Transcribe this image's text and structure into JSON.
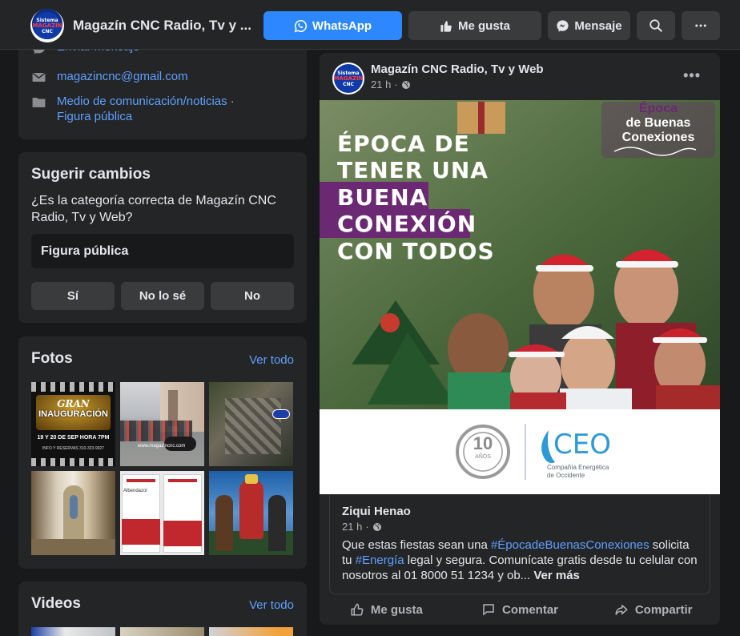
{
  "header": {
    "title": "Magazín CNC Radio, Tv y ...",
    "whatsapp_label": "WhatsApp",
    "like_label": "Me gusta",
    "message_label": "Mensaje",
    "avatar_text": [
      "Sistema",
      "Informativo",
      "Regional",
      "MAGAZÍN",
      "CNC"
    ]
  },
  "about": {
    "send_message": "Enviar mensaje",
    "email": "magazincnc@gmail.com",
    "category_1": "Medio de comunicación/noticias",
    "separator": " · ",
    "category_2": "Figura pública"
  },
  "suggest": {
    "title": "Sugerir cambios",
    "question": "¿Es la categoría correcta de Magazín CNC Radio, Tv y Web?",
    "category": "Figura pública",
    "yes": "Sí",
    "dont_know": "No lo sé",
    "no": "No"
  },
  "photos": {
    "title": "Fotos",
    "see_all": "Ver todo",
    "p1_lines": [
      "GRAN",
      "INAUGURACIÓN",
      "19 Y 20 DE SEP HORA 7PM",
      "INFO Y RESERVAS 310-323-9927"
    ],
    "p2_text": "www.magazincnc.com",
    "p5_label": "Albendazol"
  },
  "videos": {
    "title": "Videos",
    "see_all": "Ver todo"
  },
  "post": {
    "page_name": "Magazín CNC Radio, Tv y Web",
    "time": "21 h",
    "time_sep": " · ",
    "banner": {
      "lines": [
        "ÉPOCA DE",
        "TENER UNA",
        "BUENA",
        "CONEXIÓN",
        "CON TODOS"
      ],
      "tag_lines": [
        "Época",
        "de Buenas",
        "Conexiones"
      ],
      "badge_number": "10",
      "badge_word": "AÑOS",
      "logo": "CEO",
      "logo_sub_1": "Compañía Energética",
      "logo_sub_2": "de Occidente"
    },
    "shared": {
      "author": "Ziqui Henao",
      "time": "21 h",
      "time_sep": " · ",
      "text_1": "Que estas fiestas sean una ",
      "tag_1": "#ÉpocadeBuenasConexiones",
      "text_2": " solicita tu ",
      "tag_2": "#Energía",
      "text_3": " legal y segura. Comunícate gratis desde tu celular con nosotros al 01 8000 51 1234 y ob... ",
      "see_more": "Ver más"
    },
    "actions": {
      "like": "Me gusta",
      "comment": "Comentar",
      "share": "Compartir"
    }
  },
  "colors": {
    "background": "#18191a",
    "card": "#242526",
    "primary_button": "#2d88ff",
    "link": "#5fa0ff",
    "banner_purple": "#6b2873"
  }
}
